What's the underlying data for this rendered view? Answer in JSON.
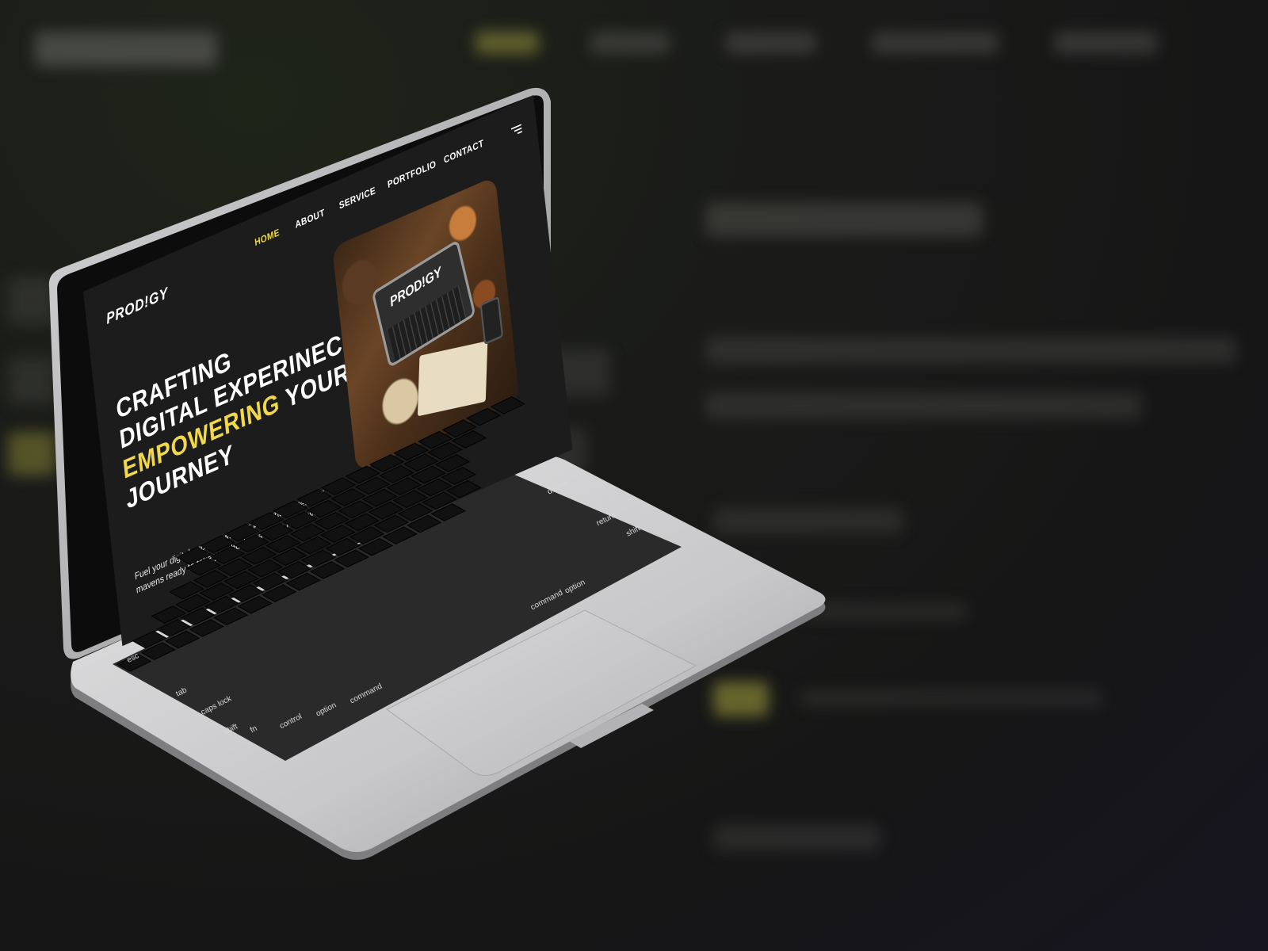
{
  "site": {
    "logo": "PROD!GY",
    "nav": [
      "HOME",
      "ABOUT",
      "SERVICE",
      "PORTFOLIO",
      "CONTACT"
    ],
    "active_nav": "HOME",
    "headline": {
      "line1": "CRAFTING",
      "line2": "DIGITAL EXPERINECE,",
      "line3_highlight": "EMPOWERING",
      "line3_rest": " YOUR",
      "line4": "JOURNEY"
    },
    "subtext": "Fuel your digital success with our powerhouse team of mavens ready to take your business to the next level!",
    "hero_image": {
      "brand_text": "PROD!GY"
    },
    "menu_icon": "hamburger-menu-icon"
  },
  "keyboard": {
    "keys": [
      "esc",
      "tab",
      "caps lock",
      "shift",
      "fn",
      "control",
      "option",
      "command",
      "delete",
      "return",
      "shift",
      "option",
      "command"
    ]
  },
  "colors": {
    "accent": "#f0d84a",
    "screen_bg": "#1c1c1c",
    "laptop_silver": "#c9c9ca",
    "keys": "#111111"
  }
}
